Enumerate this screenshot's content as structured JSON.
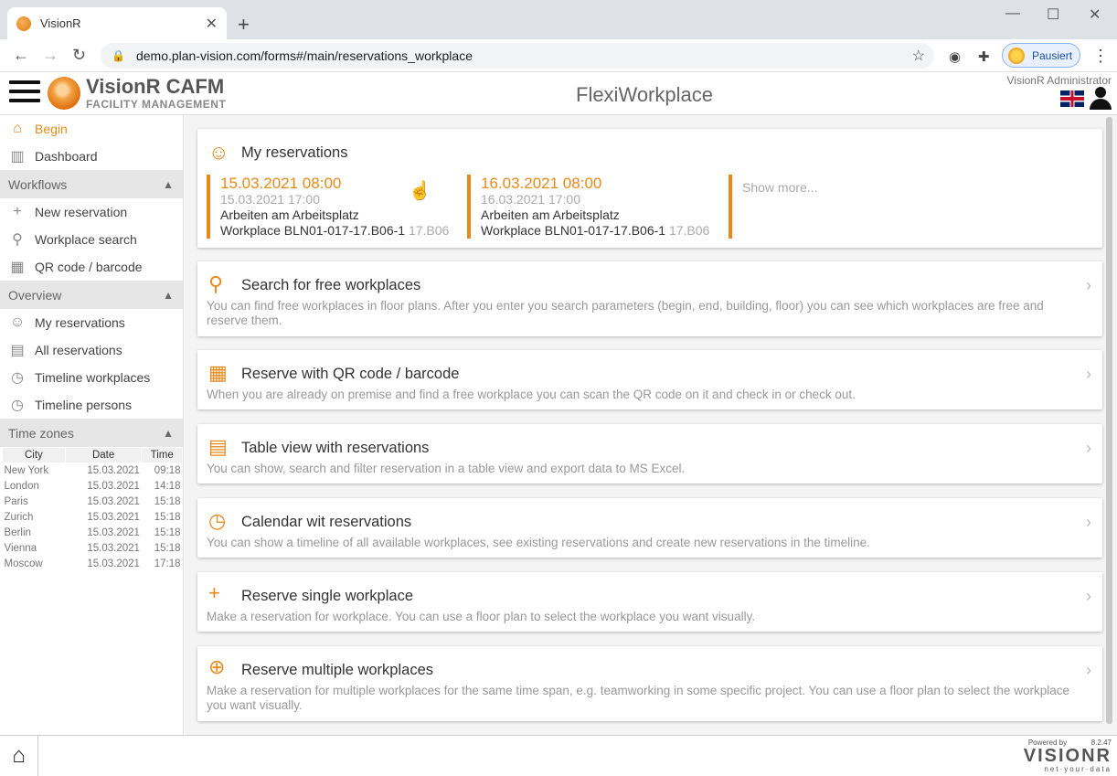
{
  "browser": {
    "tab_title": "VisionR",
    "url": "demo.plan-vision.com/forms#/main/reservations_workplace",
    "profile_label": "Pausiert"
  },
  "header": {
    "brand_name": "VisionR CAFM",
    "brand_sub": "FACILITY MANAGEMENT",
    "app_title": "FlexiWorkplace",
    "user": "VisionR Administrator"
  },
  "sidebar": {
    "items_top": [
      {
        "label": "Begin",
        "icon": "home-icon"
      },
      {
        "label": "Dashboard",
        "icon": "bar-chart-icon"
      }
    ],
    "sections": {
      "workflows": "Workflows",
      "overview": "Overview",
      "timezones": "Time zones"
    },
    "workflow_items": [
      {
        "label": "New reservation",
        "icon": "plus-icon"
      },
      {
        "label": "Workplace search",
        "icon": "search-icon"
      },
      {
        "label": "QR code / barcode",
        "icon": "qr-icon"
      }
    ],
    "overview_items": [
      {
        "label": "My reservations",
        "icon": "person-icon"
      },
      {
        "label": "All reservations",
        "icon": "calendar-icon"
      },
      {
        "label": "Timeline workplaces",
        "icon": "clock-icon"
      },
      {
        "label": "Timeline persons",
        "icon": "clock-icon"
      }
    ],
    "tz_headers": {
      "city": "City",
      "date": "Date",
      "time": "Time"
    },
    "tz_rows": [
      {
        "city": "New York",
        "date": "15.03.2021",
        "time": "09:18"
      },
      {
        "city": "London",
        "date": "15.03.2021",
        "time": "14:18"
      },
      {
        "city": "Paris",
        "date": "15.03.2021",
        "time": "15:18"
      },
      {
        "city": "Zurich",
        "date": "15.03.2021",
        "time": "15:18"
      },
      {
        "city": "Berlin",
        "date": "15.03.2021",
        "time": "15:18"
      },
      {
        "city": "Vienna",
        "date": "15.03.2021",
        "time": "15:18"
      },
      {
        "city": "Moscow",
        "date": "15.03.2021",
        "time": "17:18"
      }
    ]
  },
  "my_reservations": {
    "title": "My reservations",
    "items": [
      {
        "begin": "15.03.2021 08:00",
        "end": "15.03.2021 17:00",
        "what": "Arbeiten am Arbeitsplatz",
        "workplace": "Workplace BLN01-017-17.B06-1",
        "room": "17.B06"
      },
      {
        "begin": "16.03.2021 08:00",
        "end": "16.03.2021 17:00",
        "what": "Arbeiten am Arbeitsplatz",
        "workplace": "Workplace BLN01-017-17.B06-1",
        "room": "17.B06"
      }
    ],
    "show_more": "Show more..."
  },
  "cards": [
    {
      "title": "Search for free workplaces",
      "icon": "search-icon",
      "desc": "You can find free workplaces in floor plans. After you enter you search parameters (begin, end, building, floor) you can see which workplaces are free and reserve them."
    },
    {
      "title": "Reserve with QR code / barcode",
      "icon": "qr-icon",
      "desc": "When you are already on premise and find a free workplace you can scan the QR code on it and check in or check out."
    },
    {
      "title": "Table view with reservations",
      "icon": "calendar-icon",
      "desc": "You can show, search and filter reservation in a table view and export data to MS Excel."
    },
    {
      "title": "Calendar wit reservations",
      "icon": "clock-icon",
      "desc": "You can show a timeline of all available workplaces, see existing reservations and create new reservations in the timeline."
    },
    {
      "title": "Reserve single workplace",
      "icon": "plus-icon",
      "desc": "Make a reservation for workplace. You can use a floor plan to select the workplace you want visually."
    },
    {
      "title": "Reserve multiple workplaces",
      "icon": "plus-circle-icon",
      "desc": "Make a reservation for multiple workplaces for the same time span, e.g. teamworking in some specific project. You can use a floor plan to select the workplace you want visually."
    }
  ],
  "footer": {
    "powered_by": "Powered by",
    "version": "8.2.47",
    "logo_text": "VISIONR",
    "tagline": "net·your·data"
  },
  "colors": {
    "accent": "#e8891a"
  }
}
